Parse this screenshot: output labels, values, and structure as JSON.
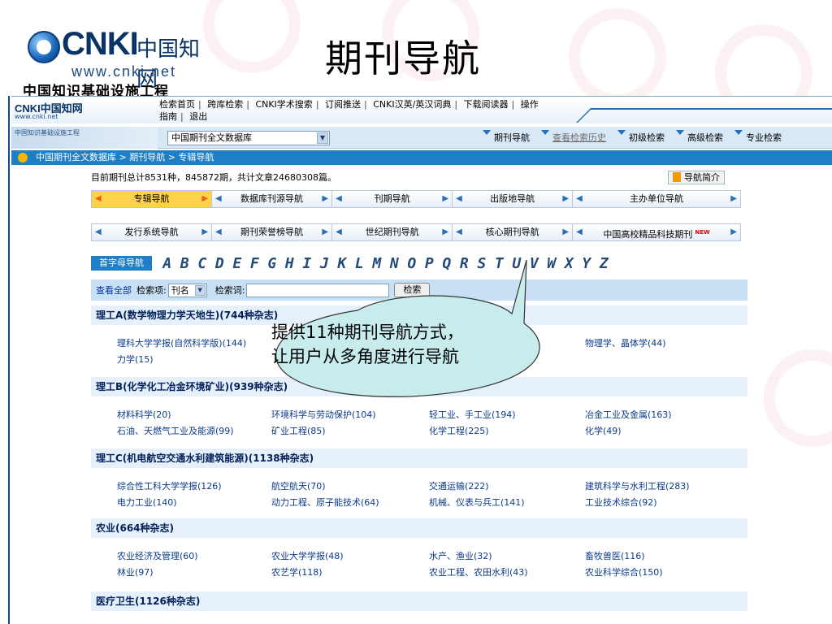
{
  "slide_title": "期刊导航",
  "logo": {
    "brand": "CNKI",
    "chinese_name": "中国知网",
    "url": "www.cnki.net",
    "subtitle": "中国知识基础设施工程"
  },
  "topbar": {
    "logo_text": "CNKI中国知网",
    "logo_url": "www.cnki.net",
    "links_row1": [
      "检索首页",
      "跨库检索",
      "CNKI学术搜索",
      "订阅推送",
      "CNKI汉英/英汉词典",
      "下载阅读器",
      "操作"
    ],
    "links_row2": [
      "指南",
      "退出"
    ]
  },
  "bar2": {
    "mark_text": "中国知识基础设施工程",
    "database_select": "中国期刊全文数据库",
    "tabs": [
      "期刊导航",
      "查看检索历史",
      "初级检索",
      "高级检索",
      "专业检索"
    ]
  },
  "breadcrumb": "中国期刊全文数据库 > 期刊导航 > 专辑导航",
  "stats": "目前期刊总计8531种，845872期，共计文章24680308篇。",
  "intro_button": "导航简介",
  "nav_row1": [
    "专辑导航",
    "数据库刊源导航",
    "刊期导航",
    "出版地导航",
    "主办单位导航"
  ],
  "nav_row2": [
    "发行系统导航",
    "期刊荣誉榜导航",
    "世纪期刊导航",
    "核心期刊导航",
    "中国高校精品科技期刊"
  ],
  "nav_new_badge": "NEW",
  "alpha": {
    "label": "首字母导航",
    "letters": [
      "A",
      "B",
      "C",
      "D",
      "E",
      "F",
      "G",
      "H",
      "I",
      "J",
      "K",
      "L",
      "M",
      "N",
      "O",
      "P",
      "Q",
      "R",
      "S",
      "T",
      "U",
      "V",
      "W",
      "X",
      "Y",
      "Z"
    ]
  },
  "search": {
    "view_all": "查看全部",
    "field_label": "检索项:",
    "field_value": "刊名",
    "term_label": "检索词:",
    "button": "检索"
  },
  "categories": [
    {
      "title": "理工A(数学物理力学天地生)(744种杂志)",
      "items": [
        "理科大学学报(自然科学版)(144)",
        "力学(15)",
        "物理学、晶体学(44)"
      ]
    },
    {
      "title": "理工B(化学化工冶金环境矿业)(939种杂志)",
      "items": [
        "材料科学(20)",
        "环境科学与劳动保护(104)",
        "轻工业、手工业(194)",
        "冶金工业及金属(163)",
        "石油、天燃气工业及能源(99)",
        "矿业工程(85)",
        "化学工程(225)",
        "化学(49)"
      ]
    },
    {
      "title": "理工C(机电航空交通水利建筑能源)(1138种杂志)",
      "items": [
        "综合性工科大学学报(126)",
        "航空航天(70)",
        "交通运输(222)",
        "建筑科学与水利工程(283)",
        "电力工业(140)",
        "动力工程、原子能技术(64)",
        "机械、仪表与兵工(141)",
        "工业技术综合(92)"
      ]
    },
    {
      "title": "农业(664种杂志)",
      "items": [
        "农业经济及管理(60)",
        "农业大学学报(48)",
        "水产、渔业(32)",
        "畜牧兽医(116)",
        "林业(97)",
        "农艺学(118)",
        "农业工程、农田水利(43)",
        "农业科学综合(150)"
      ]
    },
    {
      "title": "医疗卫生(1126种杂志)",
      "items": []
    }
  ],
  "callout": {
    "line1": "提供11种期刊导航方式，",
    "line2": "让用户从多角度进行导航"
  },
  "colors": {
    "breadcrumb_bg": "#1f7fc6",
    "active_nav": "#ffd24a",
    "link_blue": "#0b3a8c",
    "callout_fill": "#c8ecec"
  }
}
